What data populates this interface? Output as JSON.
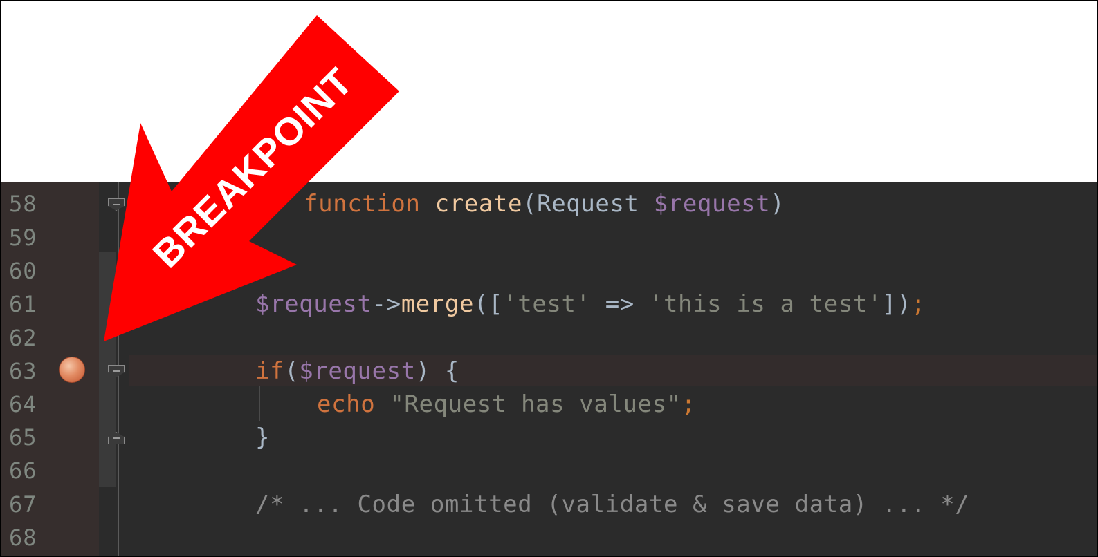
{
  "arrow": {
    "label": "BREAKPOINT",
    "color": "#ff0000",
    "text_color": "#ffffff"
  },
  "editor": {
    "background": "#2b2b2b",
    "gutter_background": "#362e2d",
    "breakpoint_line": "63",
    "breakpoint_color": "#e28b63",
    "line_numbers": [
      "58",
      "59",
      "60",
      "61",
      "62",
      "63",
      "64",
      "65",
      "66",
      "67",
      "68"
    ],
    "lines": {
      "l58": {
        "keyword": "function",
        "name": "create",
        "open": "(",
        "type": "Request",
        "param": "$request",
        "close": ")"
      },
      "l61": {
        "var": "$request",
        "arrow": "->",
        "method": "merge",
        "open": "([",
        "key": "'test'",
        "op": " => ",
        "value": "'this is a test'",
        "close": "])",
        "semi": ";"
      },
      "l63": {
        "keyword": "if",
        "open": "(",
        "var": "$request",
        "close": ") {"
      },
      "l64": {
        "keyword": "echo",
        "string": "\"Request has values\"",
        "semi": ";"
      },
      "l65": {
        "close": "}"
      },
      "l67": {
        "comment": "/* ... Code omitted (validate & save data) ... */"
      }
    }
  }
}
